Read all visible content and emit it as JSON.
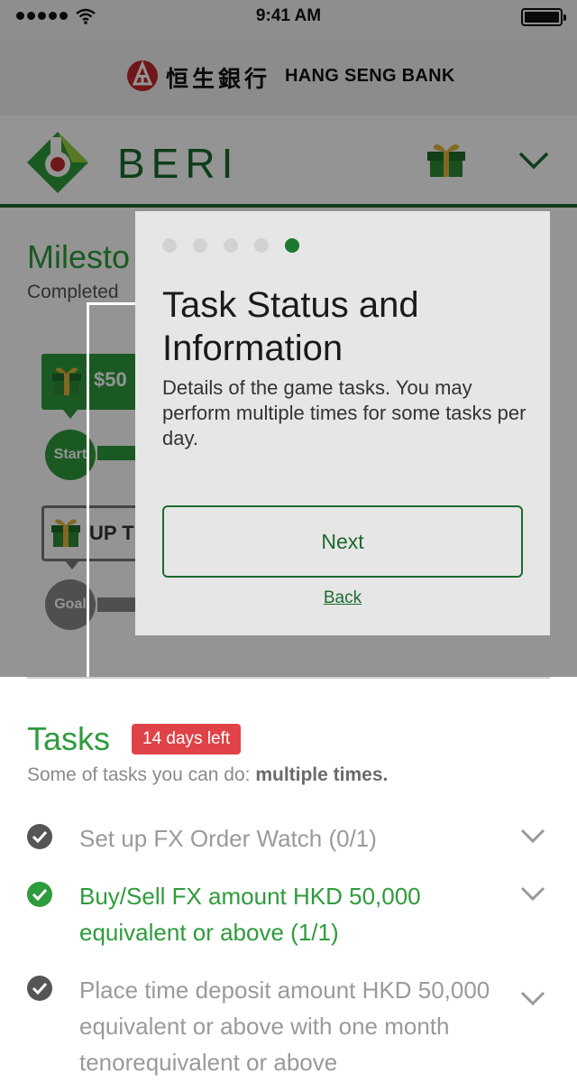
{
  "status_bar": {
    "time": "9:41 AM"
  },
  "bank": {
    "name_chinese": "恒生銀行",
    "name_english": "HANG SENG BANK"
  },
  "app": {
    "title": "BERI"
  },
  "milestone": {
    "title": "Milesto",
    "subtitle": "Completed",
    "reward_amount": "$50",
    "goal_text": "UP T",
    "start_label": "Start",
    "goal_label": "Goal"
  },
  "tooltip": {
    "steps_total": 5,
    "active_step": 5,
    "title": "Task Status and Information",
    "body": "Details of the game tasks. You may perform multiple times for some tasks per day.",
    "next_label": "Next",
    "back_label": "Back"
  },
  "tasks": {
    "title": "Tasks",
    "days_left": "14 days left",
    "subtitle_prefix": "Some of tasks you can do: ",
    "subtitle_emphasis": "multiple times.",
    "items": [
      {
        "label": "Set up FX Order Watch (0/1)",
        "done": false
      },
      {
        "label": "Buy/Sell FX amount HKD 50,000 equivalent or above (1/1)",
        "done": true
      },
      {
        "label": "Place time deposit amount HKD 50,000 equivalent or above with one month tenorequivalent or above",
        "done": false
      }
    ]
  },
  "colors": {
    "brand_green": "#1b6a2e",
    "accent_green": "#2e9b3c",
    "badge_red": "#e04347"
  }
}
